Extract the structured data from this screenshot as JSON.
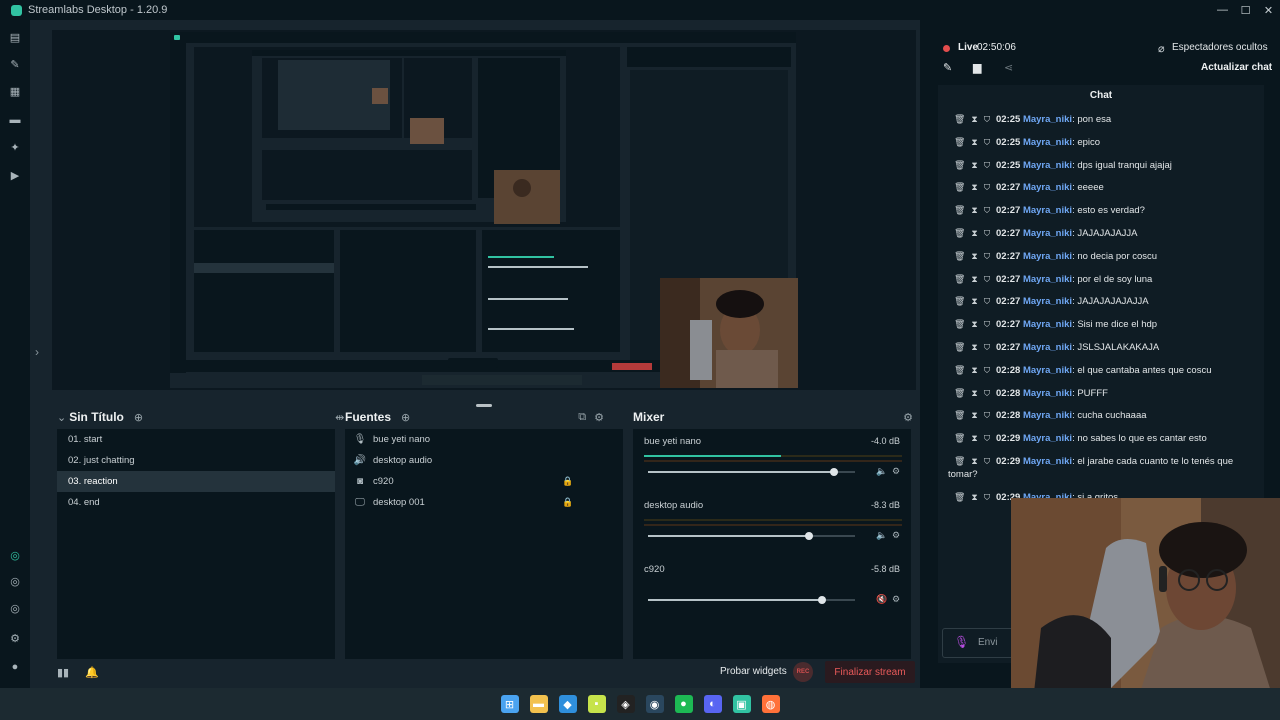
{
  "window": {
    "title": "Streamlabs Desktop - 1.20.9",
    "controls": [
      "—",
      "☐",
      "✕"
    ]
  },
  "leftnav": {
    "icons": [
      "editor-icon",
      "themes-icon",
      "store-icon",
      "overlay-icon",
      "settings-wand-icon",
      "play-icon",
      "studio-mode-icon",
      "layout-icon",
      "overlay-editor-icon",
      "settings-icon",
      "user-icon"
    ]
  },
  "scenes": {
    "title": "Sin Título",
    "items": [
      "01. start",
      "02. just chatting",
      "03. reaction",
      "04. end"
    ],
    "active_index": 2
  },
  "sources": {
    "title": "Fuentes",
    "items": [
      {
        "label": "bue yeti nano",
        "icon": "microphone-icon",
        "locked": false
      },
      {
        "label": "desktop audio",
        "icon": "speaker-icon",
        "locked": false
      },
      {
        "label": "c920",
        "icon": "webcam-icon",
        "locked": true
      },
      {
        "label": "desktop 001",
        "icon": "monitor-icon",
        "locked": true
      }
    ]
  },
  "mixer": {
    "title": "Mixer",
    "channels": [
      {
        "name": "bue yeti nano",
        "db": "-4.0 dB",
        "level": 0.53,
        "volume": 0.9,
        "muted": false
      },
      {
        "name": "desktop audio",
        "db": "-8.3 dB",
        "level": 0.0,
        "volume": 0.78,
        "muted": false
      },
      {
        "name": "c920",
        "db": "-5.8 dB",
        "level": 0.0,
        "volume": 0.84,
        "muted": true
      }
    ]
  },
  "footer": {
    "test_widgets": "Probar widgets",
    "rec": "REC",
    "end_stream": "Finalizar stream"
  },
  "live": {
    "label": "Live",
    "time": "02:50:06",
    "viewers_hidden": "Espectadores ocultos",
    "refresh_chat": "Actualizar chat"
  },
  "chat": {
    "title": "Chat",
    "input_placeholder": "Envi",
    "messages": [
      {
        "time": "02:25",
        "user": "Mayra_niki",
        "text": "pon esa"
      },
      {
        "time": "02:25",
        "user": "Mayra_niki",
        "text": "epico"
      },
      {
        "time": "02:25",
        "user": "Mayra_niki",
        "text": "dps igual tranqui ajajaj"
      },
      {
        "time": "02:27",
        "user": "Mayra_niki",
        "text": "eeeee"
      },
      {
        "time": "02:27",
        "user": "Mayra_niki",
        "text": "esto es verdad?"
      },
      {
        "time": "02:27",
        "user": "Mayra_niki",
        "text": "JAJAJAJAJJA"
      },
      {
        "time": "02:27",
        "user": "Mayra_niki",
        "text": "no decia por coscu"
      },
      {
        "time": "02:27",
        "user": "Mayra_niki",
        "text": "por el de soy luna"
      },
      {
        "time": "02:27",
        "user": "Mayra_niki",
        "text": "JAJAJAJAJAJJA"
      },
      {
        "time": "02:27",
        "user": "Mayra_niki",
        "text": "Sisi me dice el hdp"
      },
      {
        "time": "02:27",
        "user": "Mayra_niki",
        "text": "JSLSJALAKAKAJA"
      },
      {
        "time": "02:28",
        "user": "Mayra_niki",
        "text": "el que cantaba antes que coscu"
      },
      {
        "time": "02:28",
        "user": "Mayra_niki",
        "text": "PUFFF"
      },
      {
        "time": "02:28",
        "user": "Mayra_niki",
        "text": "cucha cuchaaaa"
      },
      {
        "time": "02:29",
        "user": "Mayra_niki",
        "text": "no sabes lo que es cantar esto"
      },
      {
        "time": "02:29",
        "user": "Mayra_niki",
        "text": "el jarabe cada cuanto te lo tenés que",
        "wrap": "tomar?"
      },
      {
        "time": "02:29",
        "user": "Mayra_niki",
        "text": "si a gritos"
      }
    ]
  },
  "taskbar": {
    "icons": [
      {
        "name": "windows-start-icon",
        "glyph": "⊞",
        "color": "#4aa3f0"
      },
      {
        "name": "file-explorer-icon",
        "glyph": "▬",
        "color": "#f2c14e"
      },
      {
        "name": "vscode-icon",
        "glyph": "◆",
        "color": "#2f8fdc"
      },
      {
        "name": "live-app-icon",
        "glyph": "▪",
        "color": "#c6e34b"
      },
      {
        "name": "capcut-icon",
        "glyph": "◈",
        "color": "#222222"
      },
      {
        "name": "steam-icon",
        "glyph": "◉",
        "color": "#2a475e"
      },
      {
        "name": "spotify-icon",
        "glyph": "●",
        "color": "#1db954"
      },
      {
        "name": "discord-icon",
        "glyph": "◐",
        "color": "#5865f2"
      },
      {
        "name": "streamlabs-icon",
        "glyph": "▣",
        "color": "#31c3a2"
      },
      {
        "name": "firefox-icon",
        "glyph": "◍",
        "color": "#ff7139"
      }
    ]
  }
}
